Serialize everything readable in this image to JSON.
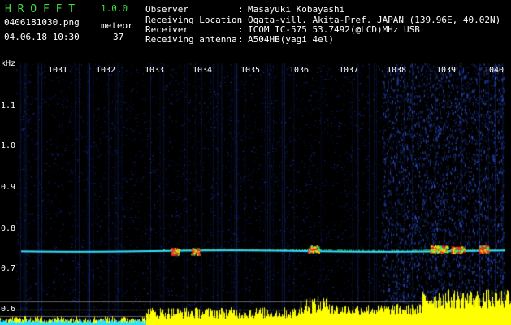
{
  "app": {
    "title": "H R O F F T",
    "version": "1.0.0",
    "filename": "0406181030.png",
    "datetime": "04.06.18 10:30",
    "counter_label": "meteor",
    "counter_value": "37"
  },
  "info": {
    "rows": [
      {
        "label": "Observer",
        "value": "Masayuki Kobayashi"
      },
      {
        "label": "Receiving Location",
        "value": "Ogata-vill. Akita-Pref. JAPAN (139.96E, 40.02N)"
      },
      {
        "label": "Receiver",
        "value": "ICOM IC-575 53.7492(@LCD)MHz USB"
      },
      {
        "label": "Receiving antenna",
        "value": "A504HB(yagi 4el)"
      }
    ],
    "separator": ":"
  },
  "axis": {
    "unit": "kHz",
    "time_ticks": [
      "1031",
      "1032",
      "1033",
      "1034",
      "1035",
      "1036",
      "1037",
      "1038",
      "1039",
      "1040"
    ],
    "freq_ticks": [
      "1.1",
      "1.0",
      "0.9",
      "0.8",
      "0.7",
      "0.6"
    ]
  },
  "colors": {
    "background": "#000000",
    "header_green": "#3fdc3f",
    "noise_blue": "#1a2fb0",
    "trace_cyan": "#38e0ff",
    "activity_yellow": "#ffff00",
    "peak_red": "#ff2020"
  }
}
